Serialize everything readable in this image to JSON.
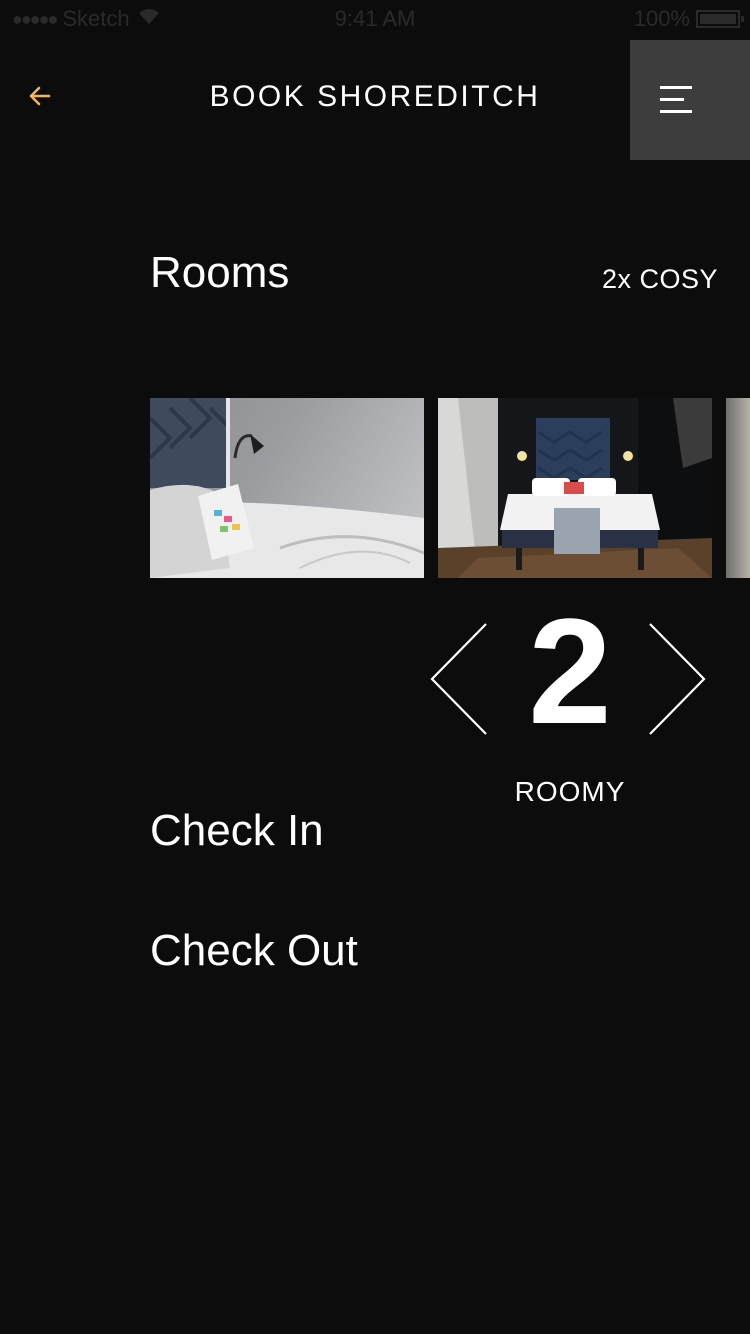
{
  "status_bar": {
    "signal_dots": "●●●●●",
    "carrier": "Sketch",
    "time": "9:41 AM",
    "battery": "100%",
    "battery_level": 1.0
  },
  "header": {
    "title": "BOOK SHOREDITCH",
    "back_icon": "arrow-left-icon",
    "menu_icon": "hamburger-menu-icon",
    "accent_color": "#f2b45c"
  },
  "rooms": {
    "label": "Rooms",
    "summary": "2x COSY",
    "photos": [
      "room-photo-cosy",
      "room-photo-roomy",
      "room-photo-next"
    ],
    "count": "2",
    "type": "ROOMY",
    "prev_icon": "chevron-left-icon",
    "next_icon": "chevron-right-icon"
  },
  "dates": {
    "check_in": "Check In",
    "check_out": "Check Out"
  }
}
